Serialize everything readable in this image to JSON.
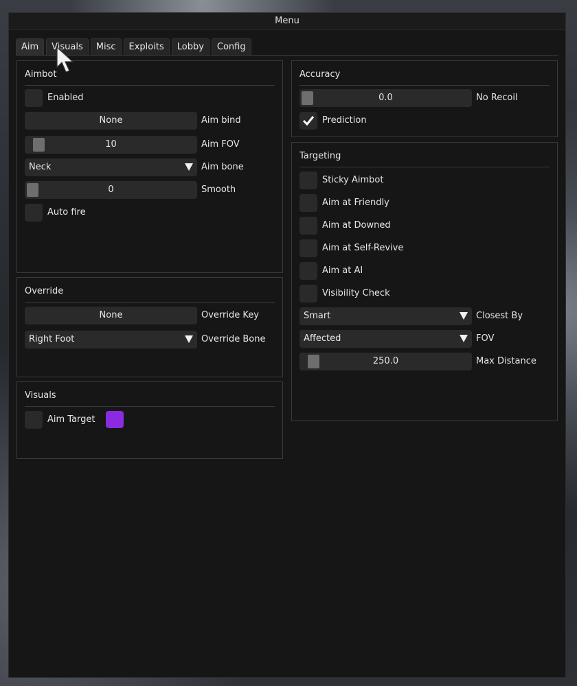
{
  "window": {
    "title": "Menu"
  },
  "tabs": [
    "Aim",
    "Visuals",
    "Misc",
    "Exploits",
    "Lobby",
    "Config"
  ],
  "aimbot": {
    "title": "Aimbot",
    "enabled_label": "Enabled",
    "enabled_checked": false,
    "bind_value": "None",
    "bind_label": "Aim bind",
    "fov_value": "10",
    "fov_label": "Aim FOV",
    "fov_fraction": 0.04,
    "bone_value": "Neck",
    "bone_label": "Aim bone",
    "smooth_value": "0",
    "smooth_label": "Smooth",
    "smooth_fraction": 0.0,
    "autofire_label": "Auto fire",
    "autofire_checked": false
  },
  "override": {
    "title": "Override",
    "key_value": "None",
    "key_label": "Override Key",
    "bone_value": "Right Foot",
    "bone_label": "Override Bone"
  },
  "visuals": {
    "title": "Visuals",
    "aim_target_label": "Aim Target",
    "aim_target_checked": false,
    "aim_target_color": "#8a2be2"
  },
  "accuracy": {
    "title": "Accuracy",
    "recoil_value": "0.0",
    "recoil_label": "No Recoil",
    "recoil_fraction": 0.0,
    "prediction_label": "Prediction",
    "prediction_checked": true
  },
  "targeting": {
    "title": "Targeting",
    "checks": [
      {
        "label": "Sticky Aimbot",
        "checked": false
      },
      {
        "label": "Aim at Friendly",
        "checked": false
      },
      {
        "label": "Aim at Downed",
        "checked": false
      },
      {
        "label": "Aim at Self-Revive",
        "checked": false
      },
      {
        "label": "Aim at AI",
        "checked": false
      },
      {
        "label": "Visibility Check",
        "checked": false
      }
    ],
    "closest_value": "Smart",
    "closest_label": "Closest By",
    "fov_value": "Affected",
    "fov_label": "FOV",
    "distance_value": "250.0",
    "distance_label": "Max Distance",
    "distance_fraction": 0.04
  },
  "colors": {
    "window_bg": "#161616",
    "frame_bg": "#2a2a2a",
    "grab": "#6e6e6e",
    "text": "#e6e6e6"
  }
}
